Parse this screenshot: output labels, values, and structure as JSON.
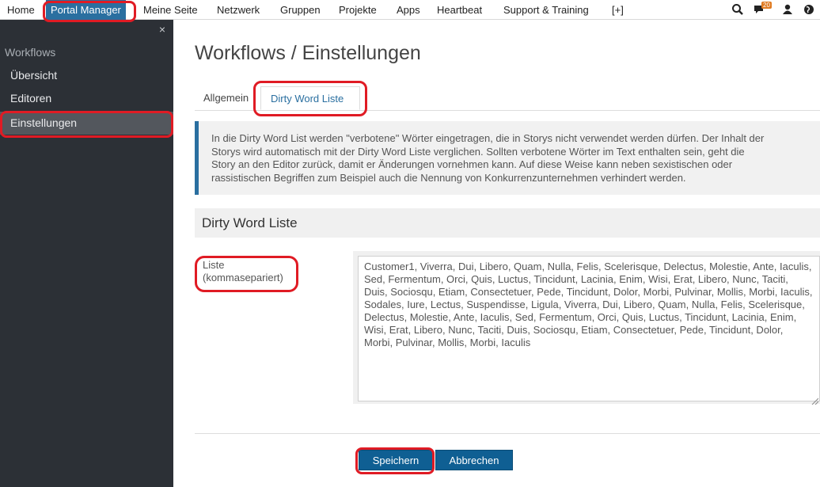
{
  "topnav": {
    "items": [
      "Home",
      "Portal Manager",
      "Meine Seite",
      "Netzwerk",
      "Gruppen",
      "Projekte",
      "Apps",
      "Heartbeat",
      "Support & Training",
      "[+]"
    ],
    "notification_count": "20",
    "icons": [
      "search-icon",
      "notifications-icon",
      "user-icon",
      "globe-icon"
    ]
  },
  "sidebar": {
    "close_glyph": "×",
    "section": "Workflows",
    "items": [
      "Übersicht",
      "Editoren",
      "Einstellungen"
    ],
    "active": "Einstellungen"
  },
  "page": {
    "title": "Workflows / Einstellungen",
    "tabs": [
      "Allgemein",
      "Dirty Word Liste"
    ],
    "active_tab": "Dirty Word Liste",
    "info_lines": [
      "In die Dirty Word List werden \"verbotene\" Wörter eingetragen, die in Storys nicht verwendet werden dürfen. Der Inhalt der",
      "Storys wird automatisch mit der Dirty Word Liste verglichen. Sollten verbotene Wörter im Text enthalten sein, geht die",
      "Story an den Editor zurück, damit er Änderungen vornehmen kann. Auf diese Weise kann neben sexistischen oder",
      "rassistischen Begriffen zum Beispiel auch die Nennung von Konkurrenzunternehmen verhindert werden."
    ],
    "section_title": "Dirty Word Liste",
    "field_label_1": "Liste",
    "field_label_2": "(kommasepariert)",
    "list_value": "Customer1, Viverra, Dui, Libero, Quam, Nulla, Felis, Scelerisque, Delectus, Molestie, Ante, Iaculis, Sed, Fermentum, Orci, Quis, Luctus, Tincidunt, Lacinia, Enim, Wisi, Erat, Libero, Nunc, Taciti, Duis, Sociosqu, Etiam, Consectetuer, Pede, Tincidunt, Dolor, Morbi, Pulvinar, Mollis, Morbi, Iaculis, Sodales, Iure, Lectus, Suspendisse, Ligula, Viverra, Dui, Libero, Quam, Nulla, Felis, Scelerisque, Delectus, Molestie, Ante, Iaculis, Sed, Fermentum, Orci, Quis, Luctus, Tincidunt, Lacinia, Enim, Wisi, Erat, Libero, Nunc, Taciti, Duis, Sociosqu, Etiam, Consectetuer, Pede, Tincidunt, Dolor, Morbi, Pulvinar, Mollis, Morbi, Iaculis",
    "save_label": "Speichern",
    "cancel_label": "Abbrechen"
  },
  "colors": {
    "accent": "#2a6fa0",
    "button": "#0f5f93",
    "sidebar_bg": "#2c3036",
    "sidebar_active": "#53575d",
    "badge": "#e07b22",
    "annotation": "#e01b24"
  }
}
